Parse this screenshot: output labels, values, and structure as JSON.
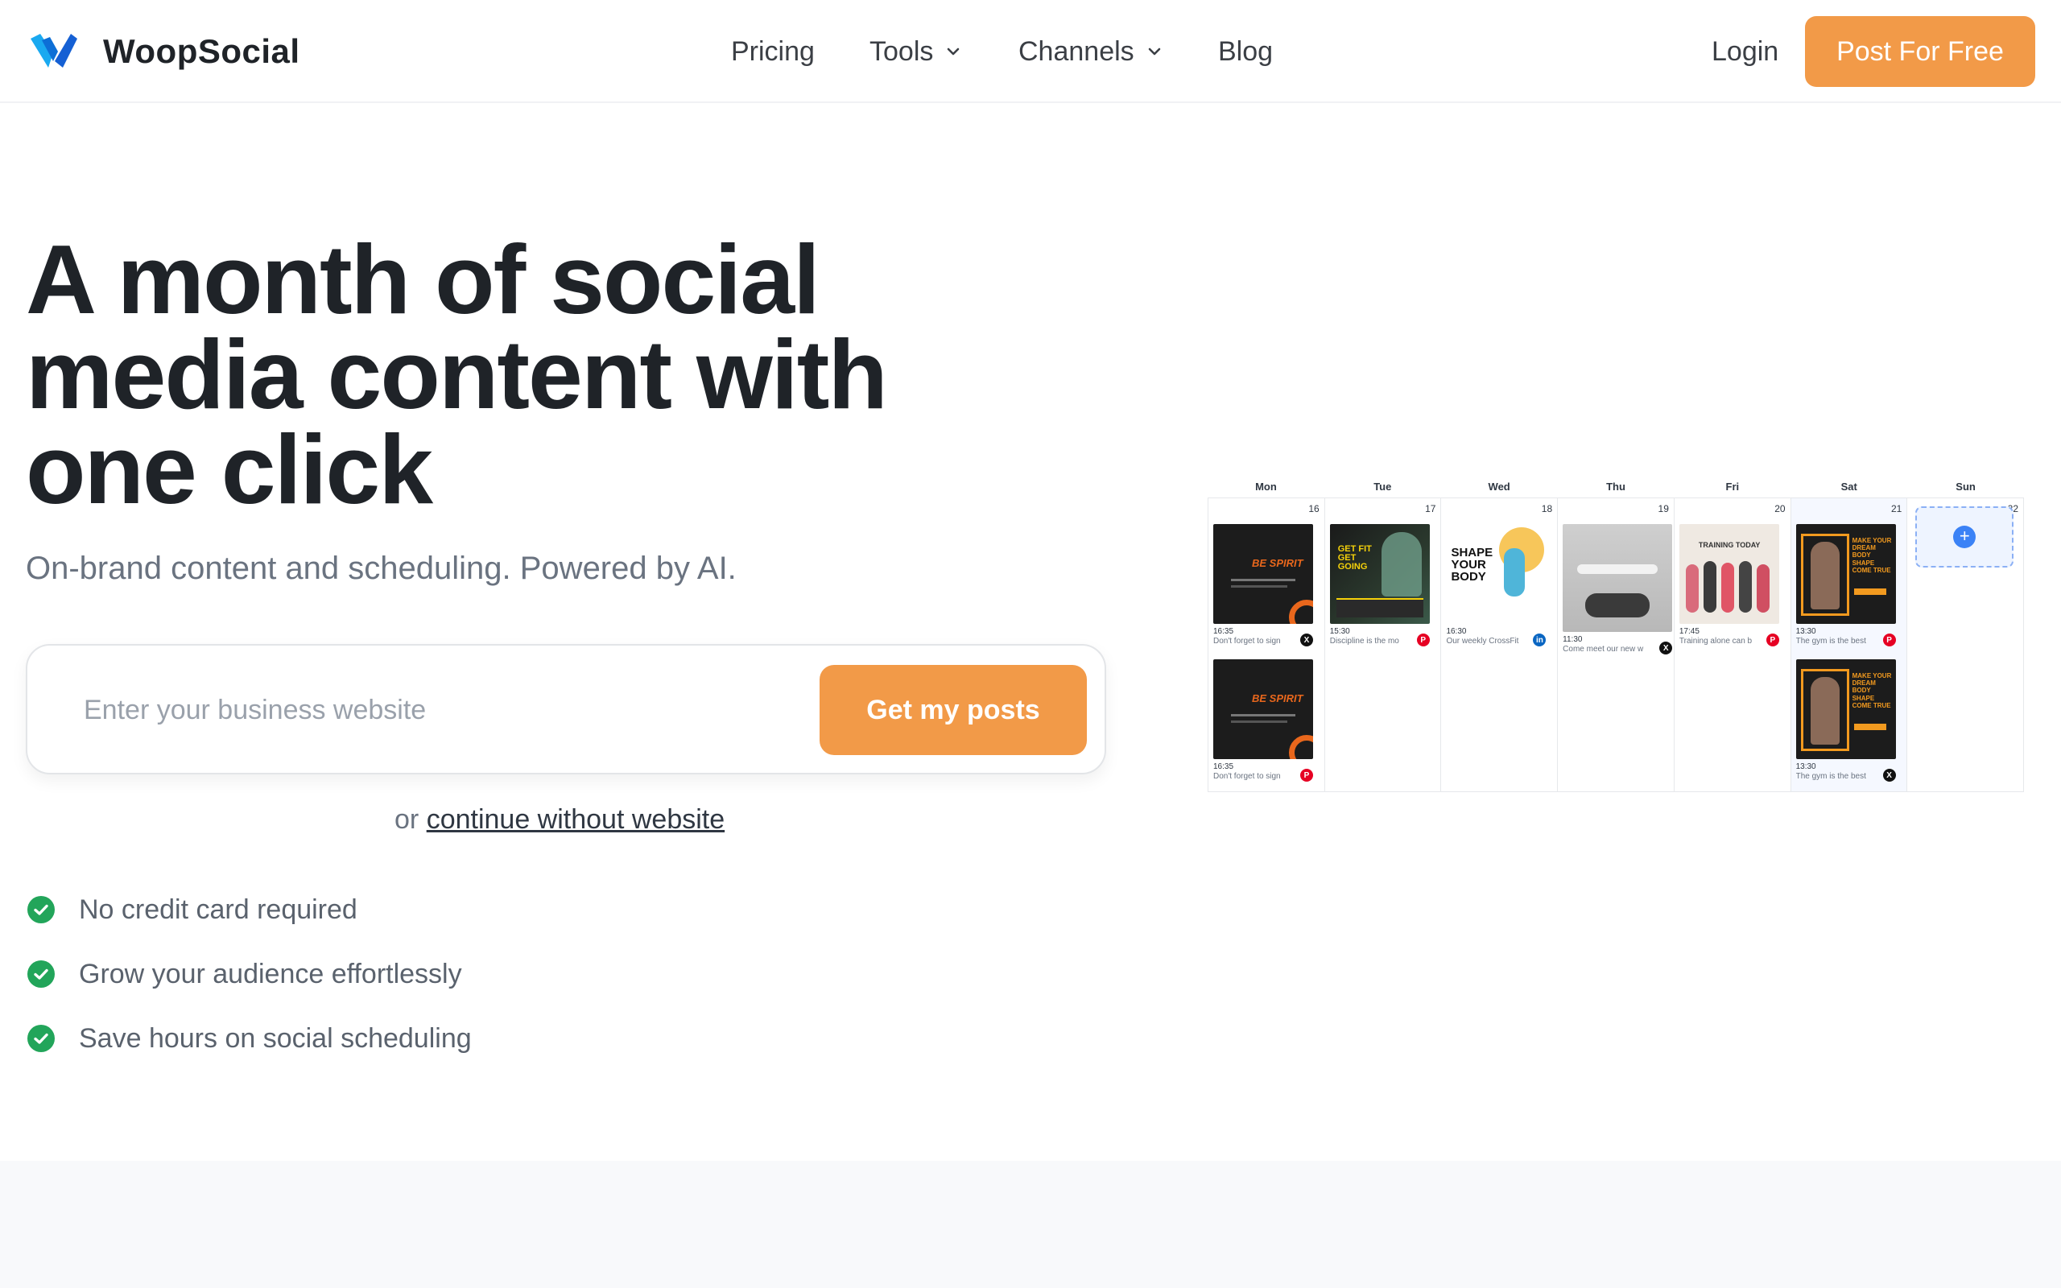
{
  "header": {
    "brand": "WoopSocial",
    "nav": [
      {
        "label": "Pricing",
        "dropdown": false
      },
      {
        "label": "Tools",
        "dropdown": true
      },
      {
        "label": "Channels",
        "dropdown": true
      },
      {
        "label": "Blog",
        "dropdown": false
      }
    ],
    "login_label": "Login",
    "cta_label": "Post For Free"
  },
  "hero": {
    "title_line1": "A month of social",
    "title_line2": "media content with",
    "title_line3": "one click",
    "subtitle": "On-brand content and scheduling. Powered by AI.",
    "search": {
      "placeholder": "Enter your business website",
      "value": "",
      "button_label": "Get my posts"
    },
    "alt_prefix": "or",
    "alt_link": "continue without website",
    "benefits": [
      "No credit card required",
      "Grow your audience effortlessly",
      "Save hours on social scheduling"
    ]
  },
  "calendar": {
    "days": [
      "Mon",
      "Tue",
      "Wed",
      "Thu",
      "Fri",
      "Sat",
      "Sun"
    ],
    "dates": [
      "16",
      "17",
      "18",
      "19",
      "20",
      "21",
      "22"
    ],
    "posts": {
      "mon_1": {
        "time": "16:35",
        "caption": "Don't forget to sign",
        "network": "x-icon",
        "art": "BE SPIRIT"
      },
      "mon_2": {
        "time": "16:35",
        "caption": "Don't forget to sign",
        "network": "pinterest-icon",
        "art": "BE SPIRIT"
      },
      "tue_1": {
        "time": "15:30",
        "caption": "Discipline is the mo",
        "network": "pinterest-icon",
        "art": "GET FIT GET GOING"
      },
      "wed_1": {
        "time": "16:30",
        "caption": "Our weekly CrossFit",
        "network": "linkedin-icon",
        "art": "SHAPE YOUR BODY"
      },
      "thu_1": {
        "time": "11:30",
        "caption": "Come meet our new w",
        "network": "x-icon"
      },
      "fri_1": {
        "time": "17:45",
        "caption": "Training alone can b",
        "network": "pinterest-icon",
        "art": "TRAINING TODAY"
      },
      "sat_1": {
        "time": "13:30",
        "caption": "The gym is the best",
        "network": "pinterest-icon",
        "art": "MAKE YOUR DREAM BODY SHAPE COME TRUE"
      },
      "sat_2": {
        "time": "13:30",
        "caption": "The gym is the best",
        "network": "x-icon",
        "art": "MAKE YOUR DREAM BODY SHAPE COME TRUE"
      }
    }
  },
  "colors": {
    "accent": "#f29a48",
    "text": "#1f2328",
    "muted": "#6a7380",
    "check": "#22a55a",
    "pinterest": "#e60023",
    "linkedin": "#0a66c2",
    "x": "#111111"
  }
}
